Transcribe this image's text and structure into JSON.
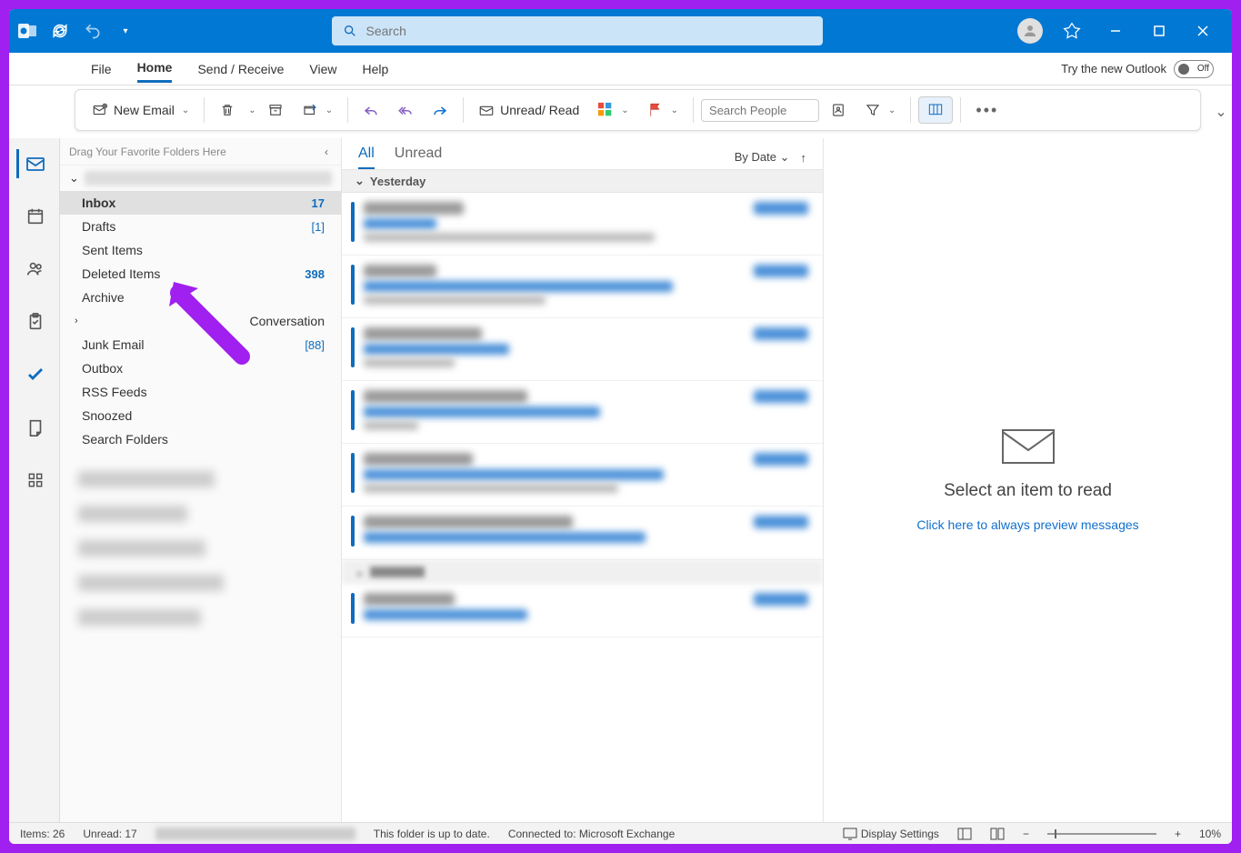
{
  "title_bar": {
    "search_placeholder": "Search"
  },
  "menu": {
    "items": [
      "File",
      "Home",
      "Send / Receive",
      "View",
      "Help"
    ],
    "active_index": 1,
    "try_new_label": "Try the new Outlook",
    "toggle_state": "Off"
  },
  "ribbon": {
    "new_email": "New Email",
    "unread_read": "Unread/ Read",
    "search_people_placeholder": "Search People"
  },
  "folders": {
    "fav_placeholder": "Drag Your Favorite Folders Here",
    "items": [
      {
        "name": "Inbox",
        "count": "17",
        "selected": true
      },
      {
        "name": "Drafts",
        "count": "[1]"
      },
      {
        "name": "Sent Items",
        "count": ""
      },
      {
        "name": "Deleted Items",
        "count": "398"
      },
      {
        "name": "Archive",
        "count": ""
      },
      {
        "name": "Conversation",
        "count": "",
        "expandable": true
      },
      {
        "name": "Junk Email",
        "count": "[88]"
      },
      {
        "name": "Outbox",
        "count": ""
      },
      {
        "name": "RSS Feeds",
        "count": ""
      },
      {
        "name": "Snoozed",
        "count": ""
      },
      {
        "name": "Search Folders",
        "count": ""
      }
    ]
  },
  "message_list": {
    "tabs": [
      "All",
      "Unread"
    ],
    "active_tab": 0,
    "sort_label": "By Date",
    "group_header": "Yesterday"
  },
  "reading_pane": {
    "title": "Select an item to read",
    "link": "Click here to always preview messages"
  },
  "status": {
    "items_label": "Items: 26",
    "unread_label": "Unread: 17",
    "folder_status": "This folder is up to date.",
    "connection": "Connected to: Microsoft Exchange",
    "display_settings": "Display Settings",
    "zoom": "10%"
  }
}
